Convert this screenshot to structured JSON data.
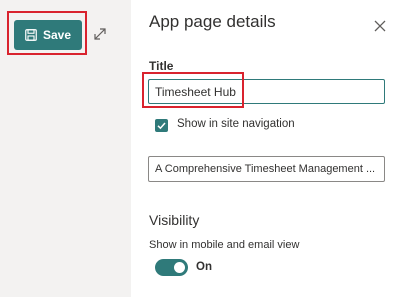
{
  "toolbar": {
    "save_label": "Save"
  },
  "panel": {
    "title": "App page details",
    "title_field": {
      "label": "Title",
      "value": "Timesheet Hub"
    },
    "show_in_nav": {
      "label": "Show in site navigation",
      "checked": true
    },
    "description": {
      "value": "A Comprehensive Timesheet Management ..."
    },
    "visibility": {
      "heading": "Visibility",
      "mobile_email_label": "Show in mobile and email view",
      "toggle_state": "On"
    }
  },
  "colors": {
    "accent": "#2f7a7a",
    "highlight": "#d9232e",
    "left_background": "#f3f2f1"
  }
}
